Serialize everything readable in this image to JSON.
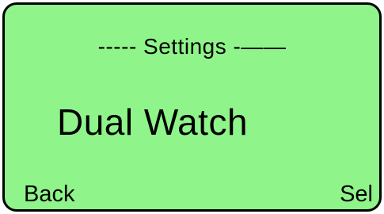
{
  "screen": {
    "header": "----- Settings -——",
    "menu_item": "Dual Watch",
    "softkeys": {
      "left": "Back",
      "right": "Sel"
    }
  },
  "colors": {
    "backlight": "#8ff58a",
    "text": "#000000",
    "bezel": "#000000"
  }
}
